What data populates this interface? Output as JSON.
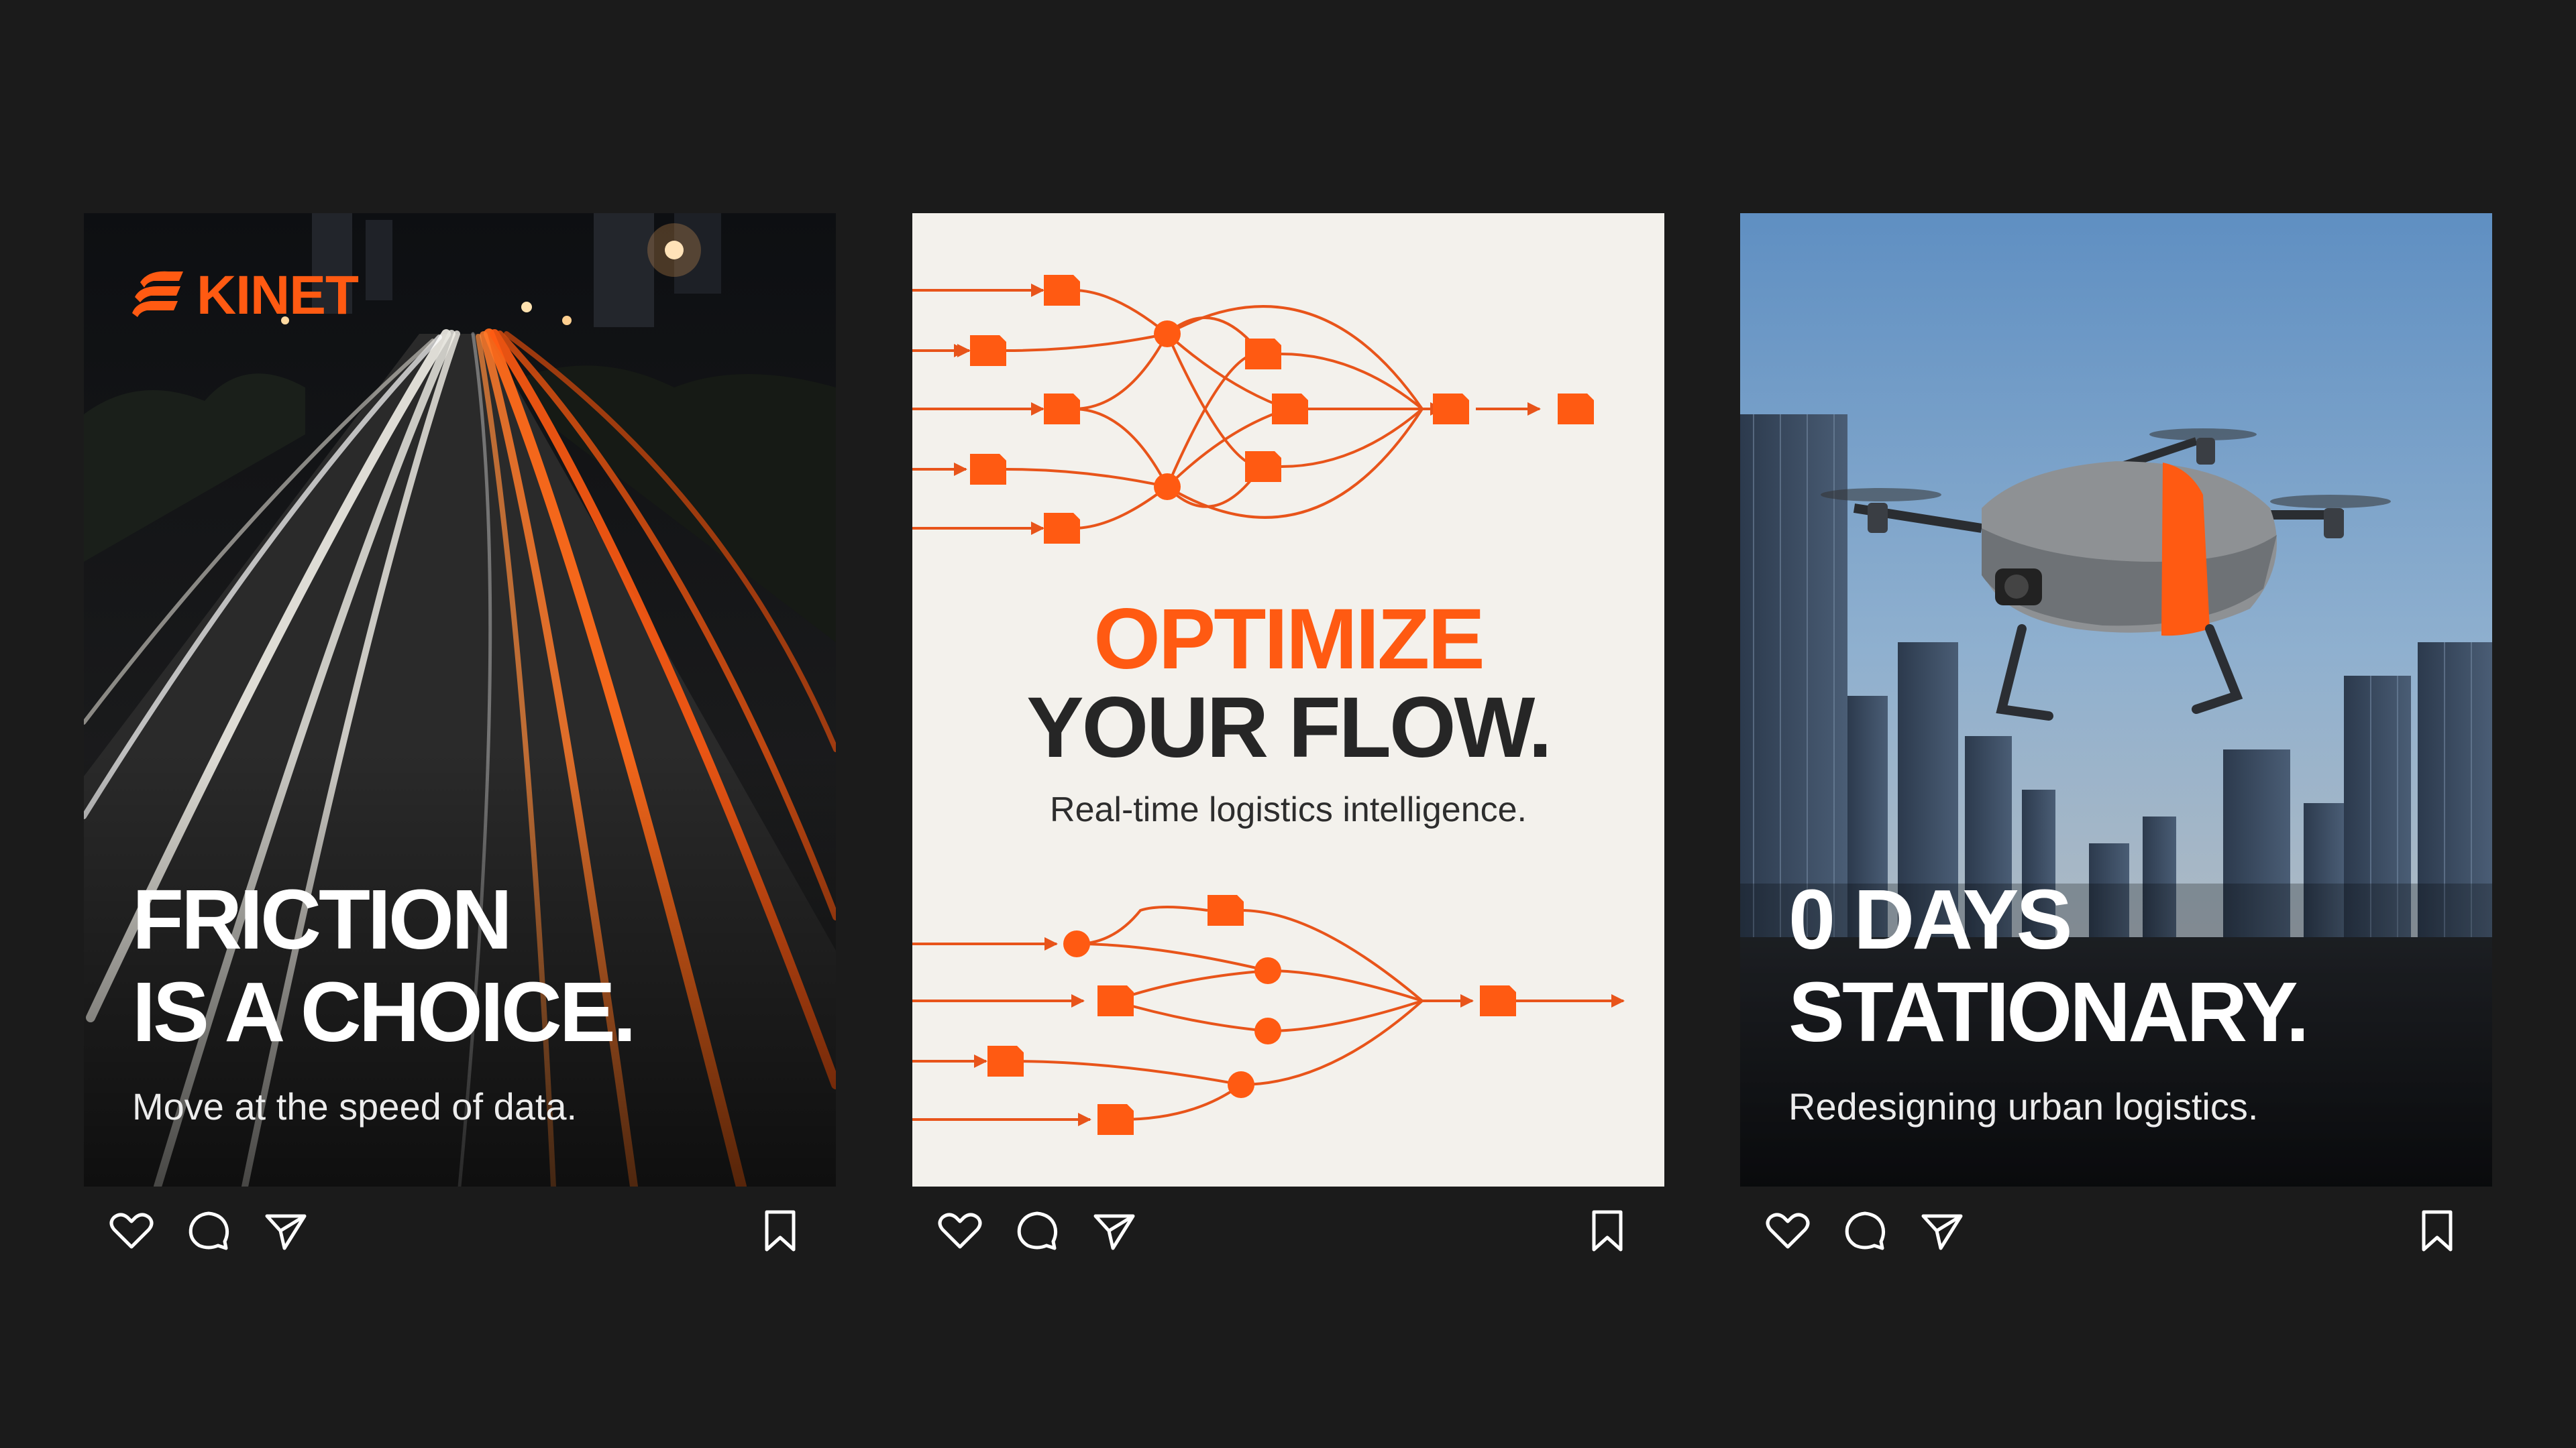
{
  "brand": {
    "name": "KINET",
    "accent_color": "#ff5a12"
  },
  "posts": [
    {
      "headline_line1": "FRICTION",
      "headline_line2": "IS A CHOICE.",
      "subline": "Move at the speed of data.",
      "image": "night-highway-light-trails"
    },
    {
      "headline_line1": "OPTIMIZE",
      "headline_line2": "YOUR FLOW.",
      "subline": "Real-time logistics intelligence.",
      "image": "orange-flow-network-diagram"
    },
    {
      "headline_line1": "0 DAYS",
      "headline_line2": "STATIONARY.",
      "subline": "Redesigning urban logistics.",
      "image": "delivery-drone-over-city"
    }
  ],
  "actions": {
    "icons": [
      "heart-icon",
      "comment-icon",
      "share-icon",
      "bookmark-icon"
    ]
  }
}
